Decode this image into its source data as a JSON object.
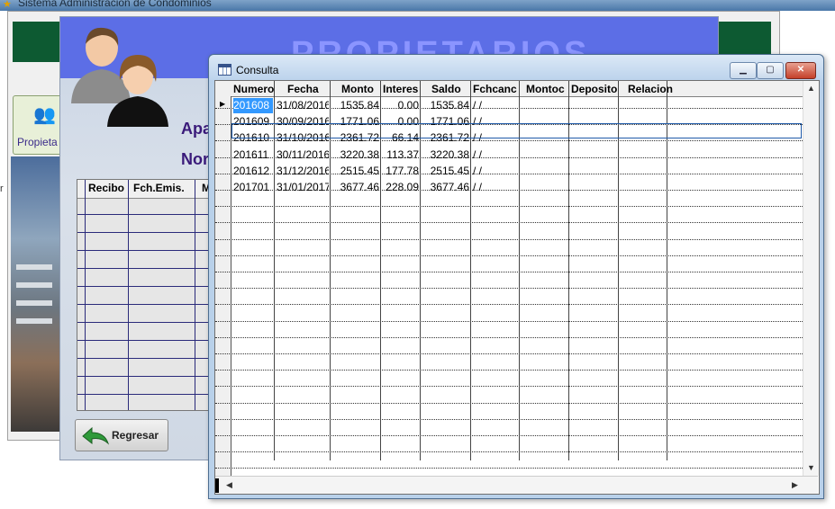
{
  "main_window": {
    "title": "Sistema Administración de Condominios",
    "propietarios_tab_label": "Propieta",
    "edge_label": "r"
  },
  "propietarios_form": {
    "banner_title": "PROPIETARIOS",
    "apartment_label": "Apa",
    "name_label": "Nor",
    "receipts_columns": [
      "Recibo",
      "Fch.Emis.",
      "M"
    ],
    "regresar_label": "Regresar"
  },
  "consulta": {
    "title": "Consulta",
    "columns": [
      "Numero",
      "Fecha",
      "Monto",
      "Interes",
      "Saldo",
      "Fchcanc",
      "Montoc",
      "Deposito",
      "Relacion"
    ],
    "rows": [
      {
        "numero": "201608",
        "fecha": "31/08/2016",
        "monto": "1535.84",
        "interes": "0.00",
        "saldo": "1535.84",
        "fchcanc": "/ /"
      },
      {
        "numero": "201609",
        "fecha": "30/09/2016",
        "monto": "1771.06",
        "interes": "0.00",
        "saldo": "1771.06",
        "fchcanc": "/ /"
      },
      {
        "numero": "201610",
        "fecha": "31/10/2016",
        "monto": "2361.72",
        "interes": "66.14",
        "saldo": "2361.72",
        "fchcanc": "/ /"
      },
      {
        "numero": "201611",
        "fecha": "30/11/2016",
        "monto": "3220.38",
        "interes": "113.37",
        "saldo": "3220.38",
        "fchcanc": "/ /"
      },
      {
        "numero": "201612",
        "fecha": "31/12/2016",
        "monto": "2515.45",
        "interes": "177.78",
        "saldo": "2515.45",
        "fchcanc": "/ /"
      },
      {
        "numero": "201701",
        "fecha": "31/01/2017",
        "monto": "3677.46",
        "interes": "228.09",
        "saldo": "3677.46",
        "fchcanc": "/ /"
      }
    ],
    "selected_cell": "201608",
    "colors": {
      "selection": "#3399ff",
      "titlebar": "#bcd3ec",
      "close": "#c5402a"
    }
  }
}
